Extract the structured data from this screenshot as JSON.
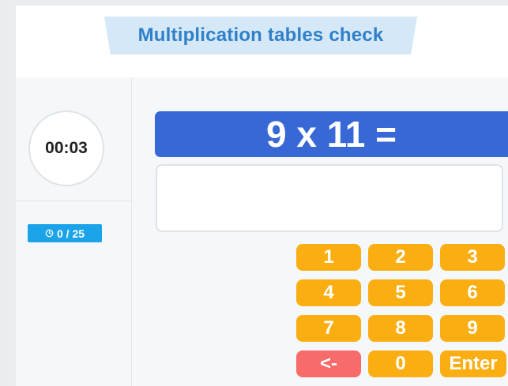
{
  "header": {
    "title": "Multiplication tables check"
  },
  "timer": {
    "value": "00:03"
  },
  "progress": {
    "icon": "clock-icon",
    "text": "0 / 25"
  },
  "question": {
    "text": "9 x 11 ="
  },
  "answer": {
    "value": ""
  },
  "keypad": {
    "keys": [
      "1",
      "2",
      "3",
      "4",
      "5",
      "6",
      "7",
      "8",
      "9",
      "<-",
      "0",
      "Enter"
    ]
  },
  "colors": {
    "accent": "#3867d6",
    "key": "#fbae12",
    "backspace": "#f76b6b",
    "badge": "#1aa3e8",
    "title_text": "#2f7fc9",
    "title_banner": "#d4e8f7"
  }
}
